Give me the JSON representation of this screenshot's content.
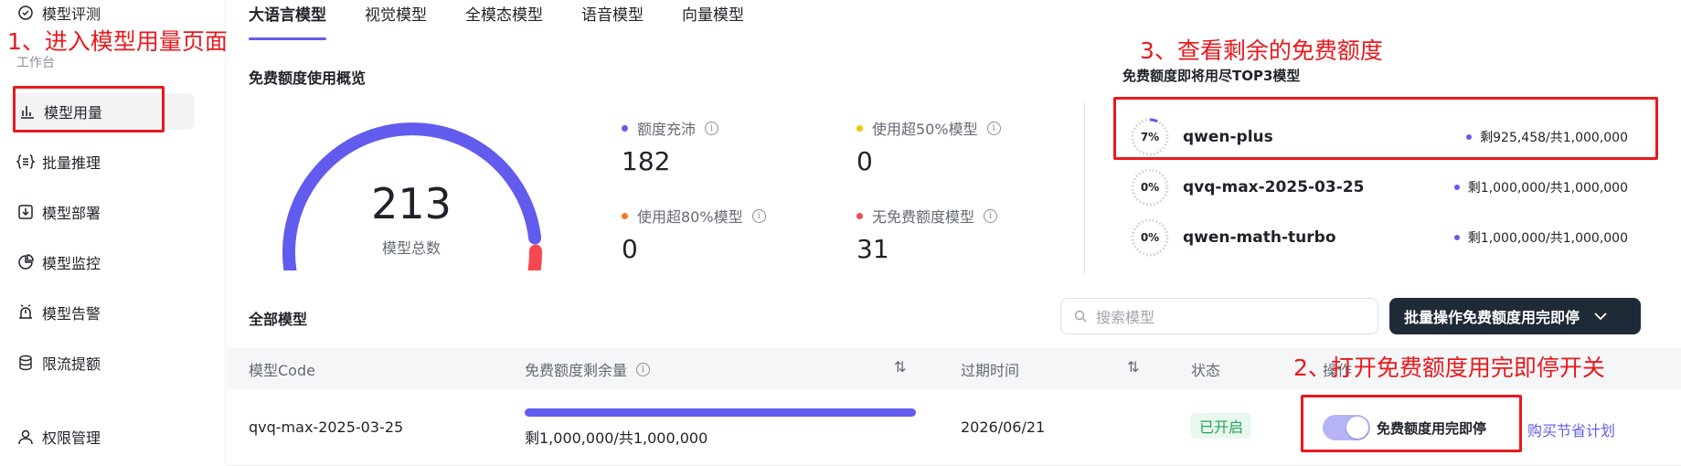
{
  "sidebar": {
    "top_item": "模型评测",
    "group_label": "工作台",
    "items": [
      {
        "label": "模型用量",
        "icon": "bar-chart-icon"
      },
      {
        "label": "批量推理",
        "icon": "list-brace-icon"
      },
      {
        "label": "模型部署",
        "icon": "deploy-icon"
      },
      {
        "label": "模型监控",
        "icon": "pie-chart-icon"
      },
      {
        "label": "模型告警",
        "icon": "alarm-icon"
      },
      {
        "label": "限流提额",
        "icon": "database-icon"
      },
      {
        "label": "权限管理",
        "icon": "user-icon"
      }
    ]
  },
  "tabs": [
    "大语言模型",
    "视觉模型",
    "全模态模型",
    "语音模型",
    "向量模型"
  ],
  "overview": {
    "title": "免费额度使用概览",
    "total": "213",
    "total_caption": "模型总数",
    "gauge_fraction_normal": 0.82,
    "stats": [
      {
        "label": "额度充沛",
        "value": "182",
        "color": "#615ced"
      },
      {
        "label": "使用超50%模型",
        "value": "0",
        "color": "#f5c400"
      },
      {
        "label": "使用超80%模型",
        "value": "0",
        "color": "#f77b15"
      },
      {
        "label": "无免费额度模型",
        "value": "31",
        "color": "#f5484f"
      }
    ]
  },
  "top3": {
    "title": "免费额度即将用尽TOP3模型",
    "items": [
      {
        "percent": "7%",
        "used_fraction": 0.07,
        "name": "qwen-plus",
        "remain": "剩925,458/共1,000,000"
      },
      {
        "percent": "0%",
        "used_fraction": 0,
        "name": "qvq-max-2025-03-25",
        "remain": "剩1,000,000/共1,000,000"
      },
      {
        "percent": "0%",
        "used_fraction": 0,
        "name": "qwen-math-turbo",
        "remain": "剩1,000,000/共1,000,000"
      }
    ]
  },
  "all_models": {
    "title": "全部模型",
    "search_placeholder": "搜索模型",
    "batch_button": "批量操作免费额度用完即停",
    "columns": [
      "模型Code",
      "免费额度剩余量",
      "过期时间",
      "状态",
      "操作"
    ],
    "rows": [
      {
        "code": "qvq-max-2025-03-25",
        "remain_fraction": 1.0,
        "remain_text": "剩1,000,000/共1,000,000",
        "expire": "2026/06/21",
        "status": "已开启",
        "toggle_label": "免费额度用完即停",
        "toggle_on": true,
        "buy_link": "购买节省计划"
      }
    ]
  },
  "annotations": {
    "step1": "1、进入模型用量页面",
    "step2": "2、打开免费额度用完即停开关",
    "step3": "3、查看剩余的免费额度",
    "color": "#e8191d"
  },
  "colors": {
    "accent": "#615ced",
    "danger": "#f5484f",
    "success": "#22a35a",
    "dark_button": "#1f2a37"
  }
}
